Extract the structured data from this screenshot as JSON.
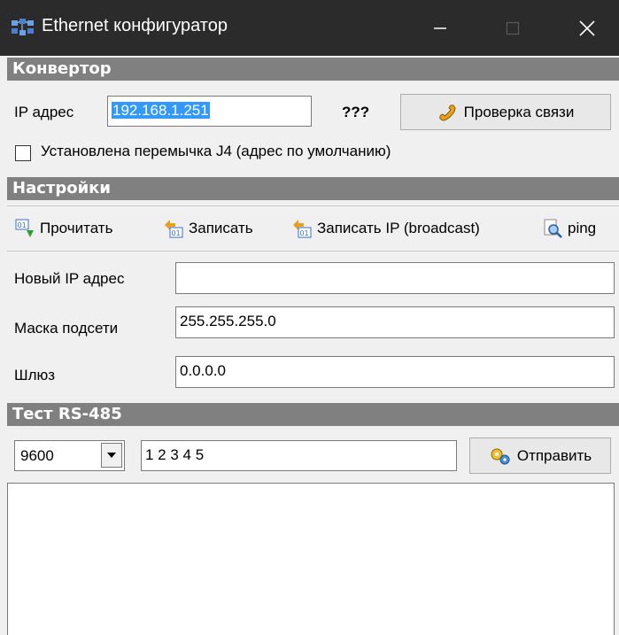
{
  "window": {
    "title": "Ethernet конфигуратор",
    "icons": {
      "app": "network-app-icon",
      "minimize": "minimize-icon",
      "maximize": "maximize-icon",
      "close": "close-icon"
    }
  },
  "converter": {
    "header": "Конвертор",
    "ip_label": "IP адрес",
    "ip_value": "192.168.1.251",
    "status": "???",
    "check_button": "Проверка связи",
    "jumper_label": "Установлена перемычка J4 (адрес по умолчанию)",
    "jumper_checked": false
  },
  "settings": {
    "header": "Настройки",
    "toolbar": {
      "read": "Прочитать",
      "write": "Записать",
      "write_ip": "Записать IP (broadcast)",
      "ping": "ping"
    },
    "new_ip_label": "Новый IP адрес",
    "new_ip_value": "",
    "mask_label": "Маска подсети",
    "mask_value": "255.255.255.0",
    "gateway_label": "Шлюз",
    "gateway_value": "0.0.0.0"
  },
  "rs485": {
    "header": "Тест RS-485",
    "baud_selected": "9600",
    "message_value": "1 2 3 4 5",
    "send_button": "Отправить",
    "output_text": ""
  },
  "colors": {
    "titlebar": "#2b2b2b",
    "section_header": "#808080",
    "selection": "#3399ff"
  }
}
